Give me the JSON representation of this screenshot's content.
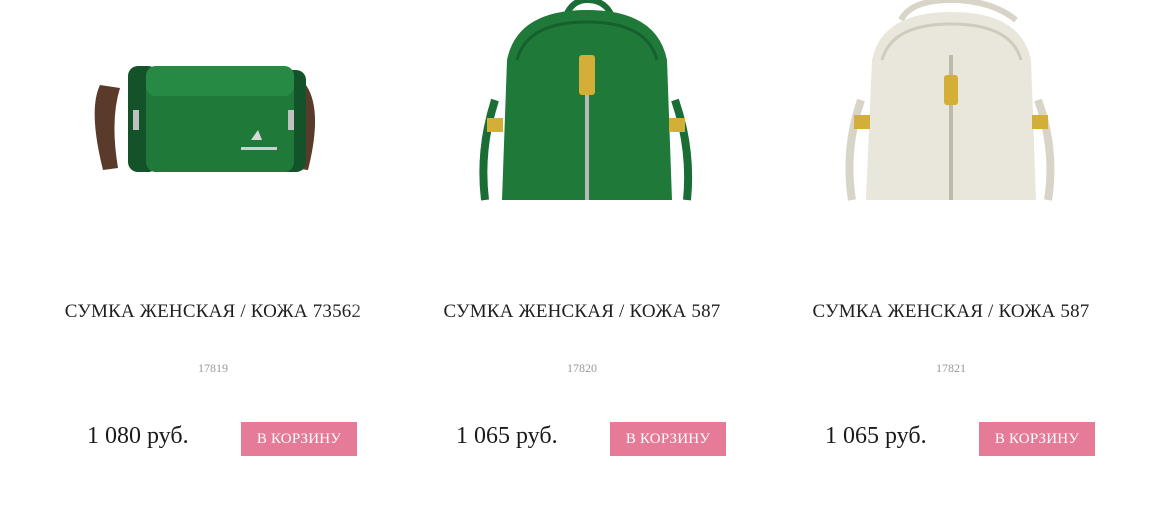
{
  "products": [
    {
      "title": "СУМКА ЖЕНСКАЯ / КОЖА 73562",
      "sku": "17819",
      "price": "1 080 руб.",
      "button_label": "В КОРЗИНУ",
      "image": "green-leather-crossbody-bag-image"
    },
    {
      "title": "СУМКА ЖЕНСКАЯ / КОЖА 587",
      "sku": "17820",
      "price": "1 065 руб.",
      "button_label": "В КОРЗИНУ",
      "image": "green-leather-mini-backpack-image"
    },
    {
      "title": "СУМКА ЖЕНСКАЯ / КОЖА 587",
      "sku": "17821",
      "price": "1 065 руб.",
      "button_label": "В КОРЗИНУ",
      "image": "white-leather-mini-backpack-image"
    }
  ],
  "colors": {
    "button_bg": "#e57b97",
    "button_text": "#ffffff",
    "sku_text": "#999999",
    "green_leather": "#1f7a3a",
    "white_leather": "#e9e6dc"
  }
}
